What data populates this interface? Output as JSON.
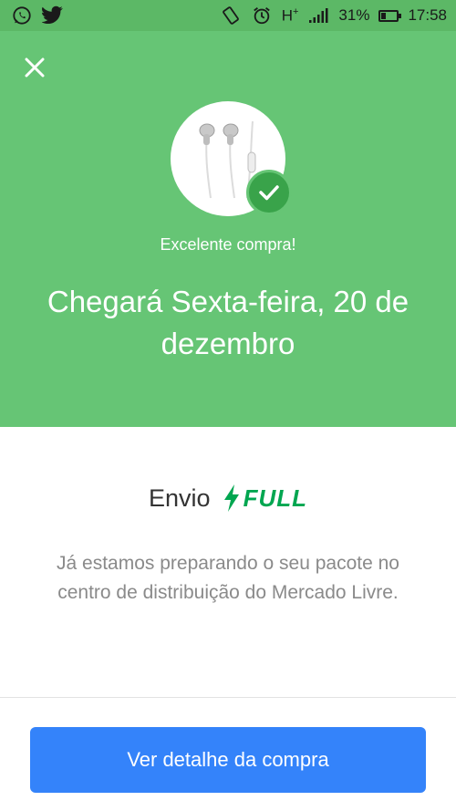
{
  "status_bar": {
    "signal_text": "H",
    "signal_sup": "+",
    "battery_percent": "31%",
    "battery_level": 0.31,
    "time": "17:58",
    "icons": [
      "whatsapp-icon",
      "twitter-icon",
      "vibrate-icon",
      "alarm-icon",
      "signal-icon",
      "battery-icon"
    ]
  },
  "confirmation": {
    "subtitle": "Excelente compra!",
    "headline": "Chegará Sexta-feira, 20 de dezembro"
  },
  "shipping": {
    "label": "Envio",
    "brand": "FULL",
    "description": "Já estamos preparando o seu pacote no centro de distribuição do Mercado Livre."
  },
  "actions": {
    "primary_label": "Ver detalhe da compra"
  },
  "colors": {
    "hero_green": "#66c575",
    "badge_green": "#39a34a",
    "full_green": "#00a650",
    "primary_blue": "#3483fa"
  }
}
